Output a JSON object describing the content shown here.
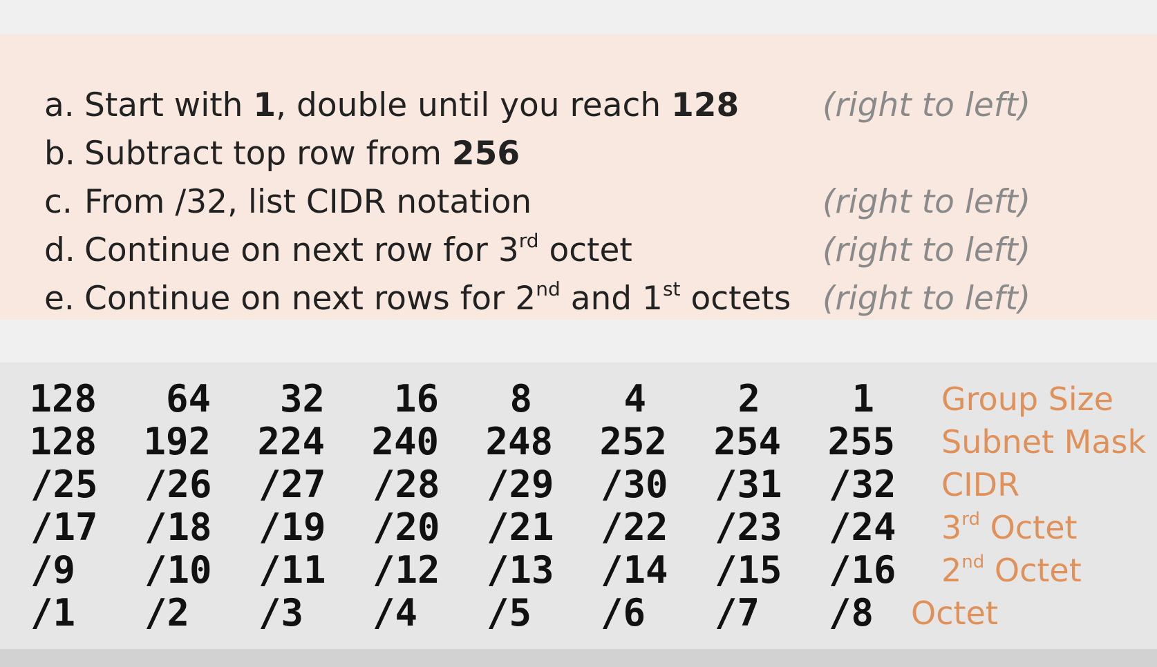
{
  "steps": [
    {
      "letter": "a.",
      "parts": [
        "Start with ",
        "1",
        ", double until you reach ",
        "128"
      ],
      "note": "(right to left)"
    },
    {
      "letter": "b.",
      "parts": [
        "Subtract top row from ",
        "256"
      ],
      "note": ""
    },
    {
      "letter": "c.",
      "text": "From /32, list CIDR notation",
      "note": "(right to left)"
    },
    {
      "letter": "d.",
      "pre": "Continue on next row for 3",
      "sup": "rd",
      "post": " octet",
      "note": "(right to left)"
    },
    {
      "letter": "e.",
      "pre": "Continue on next rows for 2",
      "sup1": "nd",
      "mid": " and 1",
      "sup2": "st",
      "post": " octets",
      "note": "(right to left)"
    }
  ],
  "table": {
    "rows": [
      {
        "cells": [
          "128",
          "64",
          "32",
          "16",
          "8",
          "4",
          "2",
          "1"
        ],
        "label": "Group Size"
      },
      {
        "cells": [
          "128",
          "192",
          "224",
          "240",
          "248",
          "252",
          "254",
          "255"
        ],
        "label": "Subnet Mask"
      },
      {
        "cells": [
          "/25",
          "/26",
          "/27",
          "/28",
          "/29",
          "/30",
          "/31",
          "/32"
        ],
        "label": "CIDR"
      },
      {
        "cells": [
          "/17",
          "/18",
          "/19",
          "/20",
          "/21",
          "/22",
          "/23",
          "/24"
        ],
        "label_num": "3",
        "label_sup": "rd",
        "label_rest": " Octet"
      },
      {
        "cells": [
          "/9",
          "/10",
          "/11",
          "/12",
          "/13",
          "/14",
          "/15",
          "/16"
        ],
        "label_num": "2",
        "label_sup": "nd",
        "label_rest": " Octet"
      },
      {
        "cells": [
          "/1",
          "/2",
          "/3",
          "/4",
          "/5",
          "/6",
          "/7",
          "/8"
        ],
        "label": "Octet"
      }
    ]
  },
  "colors": {
    "label": "#e0915a",
    "note": "#8a8a8a",
    "steps_bg": "#f8e8df"
  }
}
